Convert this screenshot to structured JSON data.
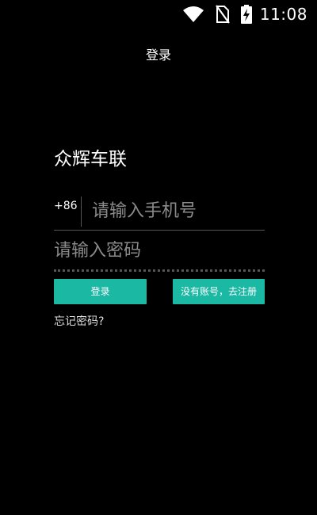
{
  "status_bar": {
    "time": "11:08",
    "icons": [
      "wifi-icon",
      "no-sim-icon",
      "battery-charging-icon"
    ]
  },
  "header": {
    "title": "登录"
  },
  "app": {
    "name": "众辉车联"
  },
  "form": {
    "country_code": "+86",
    "phone_placeholder": "请输入手机号",
    "phone_value": "",
    "password_placeholder": "请输入密码",
    "password_value": ""
  },
  "actions": {
    "login_label": "登录",
    "register_label": "没有账号，去注册",
    "forgot_label": "忘记密码?"
  },
  "colors": {
    "background": "#000000",
    "accent": "#1bb8a4",
    "divider": "#555555"
  }
}
